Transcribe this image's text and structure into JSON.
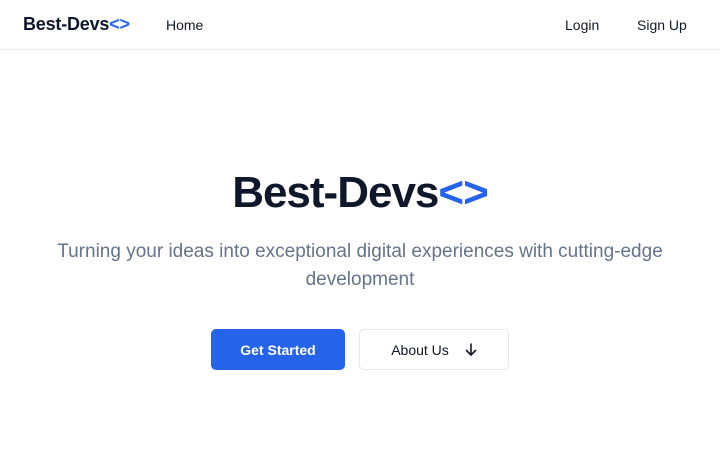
{
  "nav": {
    "brand_text": "Best-Devs",
    "brand_accent": "<>",
    "home_label": "Home",
    "login_label": "Login",
    "signup_label": "Sign Up"
  },
  "hero": {
    "title_text": "Best-Devs",
    "title_accent": "<>",
    "subtitle": "Turning your ideas into exceptional digital experiences with cutting-edge development",
    "primary_button_label": "Get Started",
    "secondary_button_label": "About Us",
    "secondary_button_icon": "arrow-down-icon"
  },
  "colors": {
    "accent": "#2563eb",
    "text_dark": "#0f172a",
    "text_muted": "#64748b",
    "border": "#e5e7eb"
  }
}
